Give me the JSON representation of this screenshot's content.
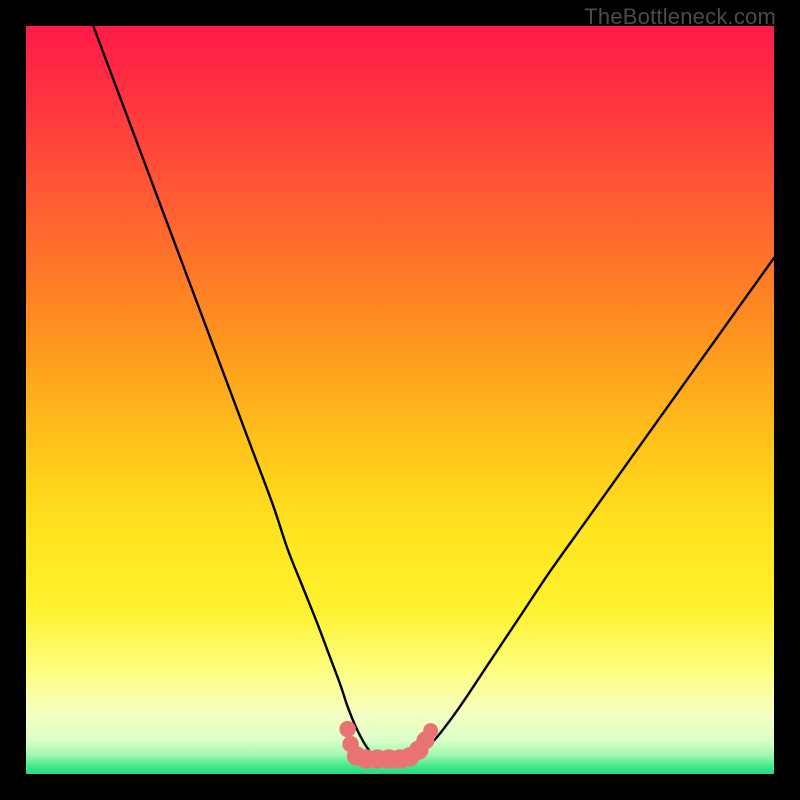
{
  "watermark": {
    "text": "TheBottleneck.com"
  },
  "colors": {
    "black": "#000000",
    "curve": "#000000",
    "marker": "#e97373",
    "gradient_stops": [
      {
        "offset": 0.0,
        "color": "#ff1a49"
      },
      {
        "offset": 0.12,
        "color": "#ff3a3e"
      },
      {
        "offset": 0.28,
        "color": "#ff6a2e"
      },
      {
        "offset": 0.4,
        "color": "#ff8f20"
      },
      {
        "offset": 0.55,
        "color": "#ffc019"
      },
      {
        "offset": 0.68,
        "color": "#ffe51f"
      },
      {
        "offset": 0.78,
        "color": "#fff22e"
      },
      {
        "offset": 0.86,
        "color": "#fdfe7e"
      },
      {
        "offset": 0.92,
        "color": "#f6ffc1"
      },
      {
        "offset": 0.955,
        "color": "#d9ffc8"
      },
      {
        "offset": 0.975,
        "color": "#9ff7b0"
      },
      {
        "offset": 0.99,
        "color": "#41e78a"
      },
      {
        "offset": 1.0,
        "color": "#23dd7e"
      }
    ]
  },
  "chart_data": {
    "type": "line",
    "title": "",
    "xlabel": "",
    "ylabel": "",
    "xlim": [
      0,
      100
    ],
    "ylim": [
      0,
      100
    ],
    "grid": false,
    "series": [
      {
        "name": "bottleneck-curve",
        "x": [
          9,
          12,
          15,
          18,
          21,
          24,
          27,
          30,
          33,
          35,
          37,
          39,
          40.5,
          42,
          43,
          44,
          45,
          46,
          47,
          48,
          49.5,
          51,
          53,
          55,
          58,
          62,
          66,
          70,
          75,
          80,
          85,
          90,
          95,
          100
        ],
        "y": [
          100,
          92,
          84,
          76,
          68,
          60,
          52,
          44,
          36,
          30,
          25,
          20,
          16,
          12,
          9,
          6.5,
          4.5,
          3,
          2.2,
          2,
          2,
          2.2,
          3,
          5,
          9,
          15,
          21,
          27,
          34,
          41,
          48,
          55,
          62,
          69
        ]
      }
    ],
    "markers": {
      "name": "valley-markers",
      "color": "#e97373",
      "points": [
        {
          "x": 43.0,
          "y": 6.0,
          "r": 1.1
        },
        {
          "x": 43.4,
          "y": 4.0,
          "r": 1.1
        },
        {
          "x": 44.2,
          "y": 2.4,
          "r": 1.3
        },
        {
          "x": 45.5,
          "y": 2.0,
          "r": 1.3
        },
        {
          "x": 47.0,
          "y": 2.0,
          "r": 1.3
        },
        {
          "x": 48.5,
          "y": 2.0,
          "r": 1.3
        },
        {
          "x": 50.0,
          "y": 2.0,
          "r": 1.3
        },
        {
          "x": 51.3,
          "y": 2.3,
          "r": 1.3
        },
        {
          "x": 52.5,
          "y": 3.2,
          "r": 1.3
        },
        {
          "x": 53.4,
          "y": 4.5,
          "r": 1.2
        },
        {
          "x": 54.1,
          "y": 5.8,
          "r": 1.0
        }
      ]
    }
  }
}
